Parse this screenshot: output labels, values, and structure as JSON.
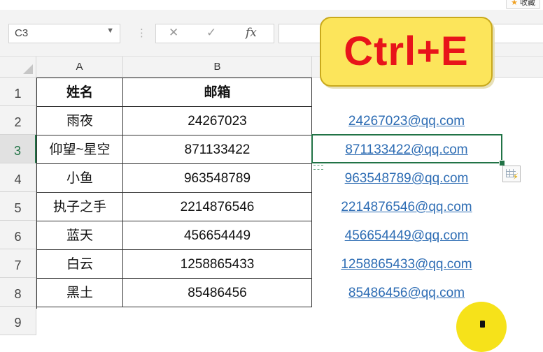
{
  "window": {
    "favorites_label": "收藏"
  },
  "formula_bar": {
    "name_box": "C3",
    "cancel_icon": "✕",
    "enter_icon": "✓",
    "fx_label": "fx",
    "formula": ""
  },
  "columns": [
    "A",
    "B"
  ],
  "rows": [
    "1",
    "2",
    "3",
    "4",
    "5",
    "6",
    "7",
    "8",
    "9"
  ],
  "table": {
    "headers": [
      "姓名",
      "邮箱"
    ],
    "rows": [
      [
        "雨夜",
        "24267023"
      ],
      [
        "仰望~星空",
        "871133422"
      ],
      [
        "小鱼",
        "963548789"
      ],
      [
        "执子之手",
        "2214876546"
      ],
      [
        "蓝天",
        "456654449"
      ],
      [
        "白云",
        "1258865433"
      ],
      [
        "黑土",
        "85486456"
      ]
    ]
  },
  "emails": [
    "24267023@qq.com",
    "871133422@qq.com",
    "963548789@qq.com",
    "2214876546@qq.com",
    "456654449@qq.com",
    "1258865433@qq.com",
    "85486456@qq.com"
  ],
  "callout": {
    "text": "Ctrl+E"
  },
  "colors": {
    "accent": "#217346",
    "callout_bg": "#fce55b",
    "callout_text": "#e8141a",
    "link": "#2e6db4"
  }
}
